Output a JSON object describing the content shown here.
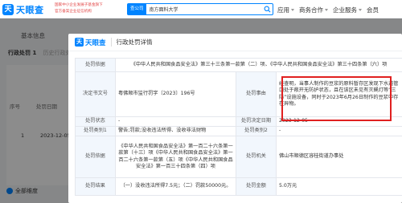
{
  "header": {
    "logo_mark": "天",
    "logo_text": "天眼查",
    "slogan_line1": "国家中小企业发展子基金旗下",
    "slogan_line2": "官方备案企业征信机构",
    "search_tag": "查公司",
    "search_value": "南方面料大学",
    "nav": [
      "应用",
      "商务合作",
      "企业服务",
      "会员"
    ]
  },
  "background": {
    "basic_tab": "基本信息",
    "penalty_tab": "行政处罚",
    "penalty_count": "1",
    "history_tab": "历史行政处罚",
    "col_no": "序号",
    "col_date": "处罚日期",
    "row_no": "1",
    "row_date": "2023-12-05",
    "bottom_label": "全部维度"
  },
  "modal": {
    "brand": "天眼查",
    "title": "行政处罚详情",
    "rows": {
      "basis_label": "处罚依据",
      "basis_value": "《中华人民共和国食品安全法》第三十三条第一款第（二）项、《中华人民共和国食品安全法》第三十四条第（六）项",
      "docno_label": "决定书文号",
      "docno_value": "粤佛顺市监行罚字〔2023〕196号",
      "reason_label": "处罚事由",
      "reason_value": "经查明，当事人制作的豆浆的原料暂存区发现下水道管口处于敞开无防护状态，且在该区未见有灭蝇灯等“三防”设施设备，同时于2023年6月26日制作的豆浆中存在异物。",
      "status_label": "处罚状态",
      "status_value": "-",
      "date_label": "处罚决定日期",
      "date_value": "2023-12-05",
      "category_label": "处罚类别1",
      "category_value": "警告;罚款;没收违法所得、没收非法财物",
      "category2_label": "处罚类别2",
      "category2_value": "-",
      "law_label": "处罚依据",
      "law_value": "《中华人民共和国食品安全法》第一百二十六条第一款第（十三）项《中华人民共和国食品安全法》第一百二十六条第一款第（五）项《中华人民共和国食品安全法》第一百三十四条第（四）项",
      "authority_label": "处罚机关",
      "authority_value": "佛山市顺德区容桂街道办事处",
      "result_label": "处罚结果",
      "result_value": "（一）没收违法所得7.5元；（二）罚款50000元。",
      "amount_label": "处罚金额",
      "amount_value": "5.0万元"
    }
  }
}
